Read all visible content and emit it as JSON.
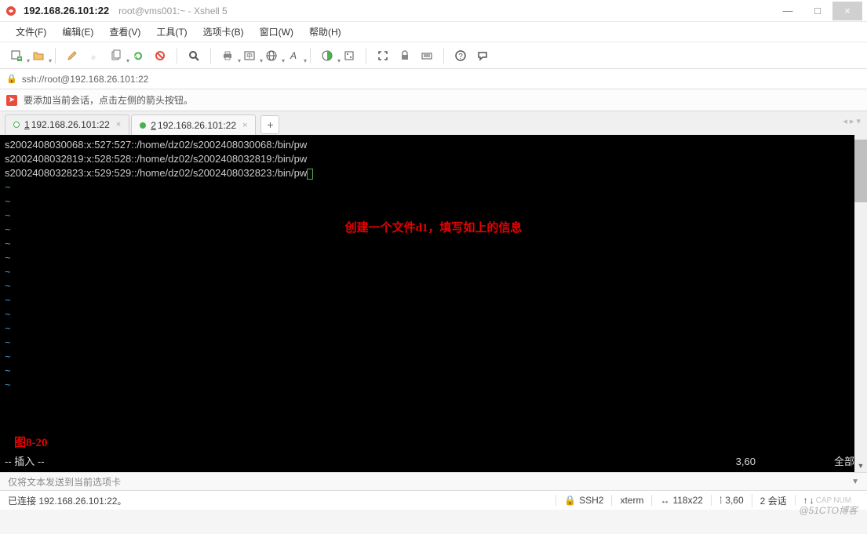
{
  "title": {
    "address": "192.168.26.101:22",
    "sub": "root@vms001:~ - Xshell 5"
  },
  "window_buttons": {
    "min": "—",
    "max": "□",
    "close": "×"
  },
  "menu": [
    "文件(F)",
    "编辑(E)",
    "查看(V)",
    "工具(T)",
    "选项卡(B)",
    "窗口(W)",
    "帮助(H)"
  ],
  "toolbar_icons": [
    "new-session",
    "open",
    "copy",
    "paste",
    "properties",
    "reconnect",
    "disconnect",
    "search",
    "print",
    "encoding",
    "globe",
    "font",
    "color",
    "script",
    "fullscreen",
    "lock",
    "keyboard",
    "help",
    "feedback"
  ],
  "addressbar": {
    "url": "ssh://root@192.168.26.101:22"
  },
  "hint": {
    "text": "要添加当前会话，点击左侧的箭头按钮。"
  },
  "tabs": [
    {
      "num": "1",
      "label": "192.168.26.101:22",
      "active": true,
      "dot": "white"
    },
    {
      "num": "2",
      "label": "192.168.26.101:22",
      "active": false,
      "dot": "green"
    }
  ],
  "new_tab": "+",
  "terminal": {
    "lines": [
      "s2002408030068:x:527:527::/home/dz02/s2002408030068:/bin/pw",
      "s2002408032819:x:528:528::/home/dz02/s2002408032819:/bin/pw",
      "s2002408032823:x:529:529::/home/dz02/s2002408032823:/bin/pw"
    ],
    "blank_tilde_rows": 15,
    "annotation_center": "创建一个文件d1，填写如上的信息",
    "annotation_bottom": "图8-20",
    "mode": "-- 插入 --",
    "cursor_pos": "3,60",
    "scroll_label": "全部"
  },
  "send_hint": "仅将文本发送到当前选项卡",
  "statusbar": {
    "conn": "已连接 192.168.26.101:22。",
    "proto": "SSH2",
    "term": "xterm",
    "size": "118x22",
    "pos": "3,60",
    "sessions": "2 会话",
    "caps": "CAP",
    "num": "NUM"
  },
  "watermark": "@51CTO博客",
  "colors": {
    "accent_red": "#e80000",
    "tilde": "#4aa0d8"
  }
}
